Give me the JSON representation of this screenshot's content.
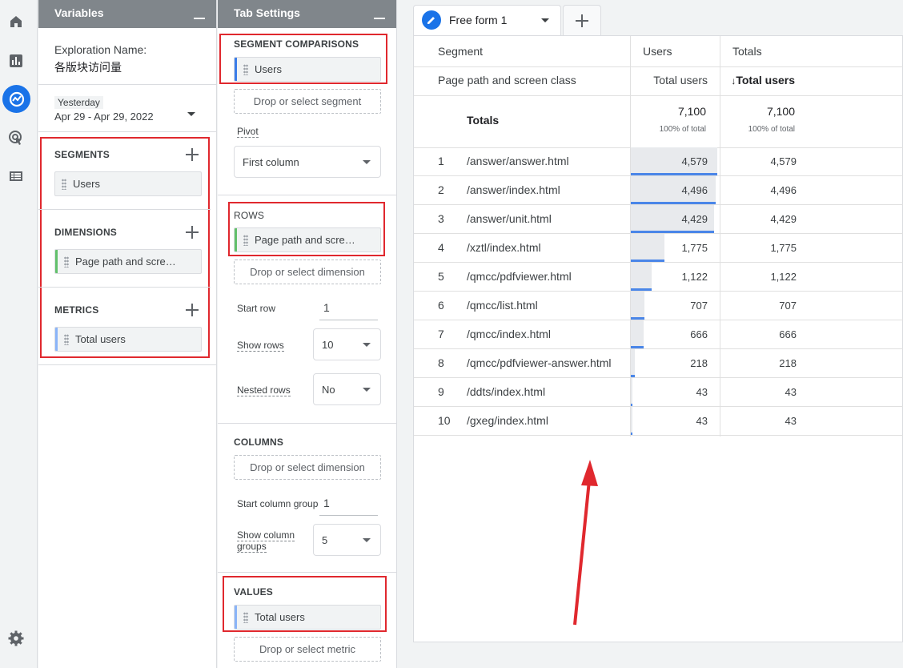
{
  "colors": {
    "accent": "#1a73e8",
    "header_gray": "#80868b",
    "highlight_red": "#e0282e",
    "segment_bar": "#3b7de9",
    "dimension_bar": "#62c06b",
    "metric_bar": "#8ab4f8"
  },
  "rail": {
    "icons": [
      "home-icon",
      "reports-icon",
      "explore-icon",
      "advertising-icon",
      "configure-icon",
      "settings-icon"
    ]
  },
  "variables": {
    "title": "Variables",
    "exploration_label": "Exploration Name:",
    "exploration_name": "各版块访问量",
    "date_preset": "Yesterday",
    "date_range": "Apr 29 - Apr 29, 2022",
    "segments_title": "SEGMENTS",
    "segment_item": "Users",
    "dimensions_title": "DIMENSIONS",
    "dimension_item": "Page path and scre…",
    "metrics_title": "METRICS",
    "metric_item": "Total users"
  },
  "tab_settings": {
    "title": "Tab Settings",
    "segment_comparisons_title": "SEGMENT COMPARISONS",
    "segment_comparison_item": "Users",
    "drop_segment": "Drop or select segment",
    "pivot_label": "Pivot",
    "pivot_value": "First column",
    "rows_title": "ROWS",
    "rows_item": "Page path and scre…",
    "drop_dimension_rows": "Drop or select dimension",
    "start_row_label": "Start row",
    "start_row_value": "1",
    "show_rows_label": "Show rows",
    "show_rows_value": "10",
    "nested_rows_label": "Nested rows",
    "nested_rows_value": "No",
    "columns_title": "COLUMNS",
    "drop_dimension_columns": "Drop or select dimension",
    "start_column_group_label": "Start column group",
    "start_column_group_value": "1",
    "show_column_groups_label": "Show column groups",
    "show_column_groups_value": "5",
    "values_title": "VALUES",
    "values_item": "Total users",
    "drop_metric": "Drop or select metric"
  },
  "tabs": {
    "active_label": "Free form 1"
  },
  "table": {
    "header_segment": "Segment",
    "header_dimension": "Page path and screen class",
    "col1_segment": "Users",
    "col1_metric": "Total users",
    "col2_segment": "Totals",
    "col2_metric": "Total users",
    "sort_arrow": "↓",
    "totals_label": "Totals",
    "total_value": "7,100",
    "total_pct": "100% of total",
    "rows": [
      {
        "rank": "1",
        "path": "/answer/answer.html",
        "users": "4,579",
        "total": "4,579",
        "v": 4579
      },
      {
        "rank": "2",
        "path": "/answer/index.html",
        "users": "4,496",
        "total": "4,496",
        "v": 4496
      },
      {
        "rank": "3",
        "path": "/answer/unit.html",
        "users": "4,429",
        "total": "4,429",
        "v": 4429
      },
      {
        "rank": "4",
        "path": "/xztl/index.html",
        "users": "1,775",
        "total": "1,775",
        "v": 1775
      },
      {
        "rank": "5",
        "path": "/qmcc/pdfviewer.html",
        "users": "1,122",
        "total": "1,122",
        "v": 1122
      },
      {
        "rank": "6",
        "path": "/qmcc/list.html",
        "users": "707",
        "total": "707",
        "v": 707
      },
      {
        "rank": "7",
        "path": "/qmcc/index.html",
        "users": "666",
        "total": "666",
        "v": 666
      },
      {
        "rank": "8",
        "path": "/qmcc/pdfviewer-answer.html",
        "users": "218",
        "total": "218",
        "v": 218
      },
      {
        "rank": "9",
        "path": "/ddts/index.html",
        "users": "43",
        "total": "43",
        "v": 43
      },
      {
        "rank": "10",
        "path": "/gxeg/index.html",
        "users": "43",
        "total": "43",
        "v": 43
      }
    ]
  }
}
